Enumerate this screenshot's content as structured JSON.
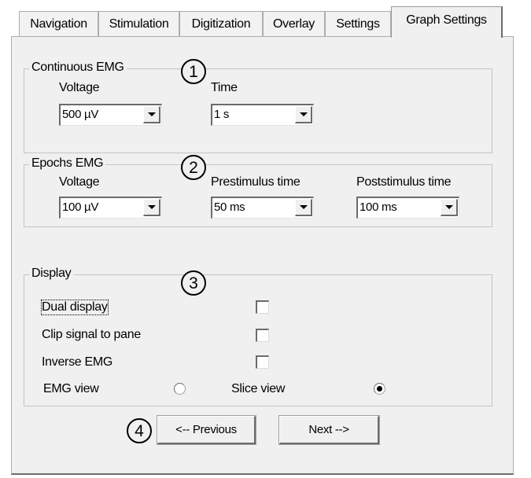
{
  "tabs": [
    {
      "label": "Navigation"
    },
    {
      "label": "Stimulation"
    },
    {
      "label": "Digitization"
    },
    {
      "label": "Overlay"
    },
    {
      "label": "Settings"
    },
    {
      "label": "Graph Settings"
    }
  ],
  "active_tab": "Graph Settings",
  "continuous_emg": {
    "title": "Continuous EMG",
    "marker": "1",
    "voltage_label": "Voltage",
    "voltage_value": "500 µV",
    "time_label": "Time",
    "time_value": "1 s"
  },
  "epochs_emg": {
    "title": "Epochs EMG",
    "marker": "2",
    "voltage_label": "Voltage",
    "voltage_value": "100 µV",
    "prestim_label": "Prestimulus time",
    "prestim_value": "50 ms",
    "poststim_label": "Poststimulus time",
    "poststim_value": "100 ms"
  },
  "display": {
    "title": "Display",
    "marker": "3",
    "dual_display_label": "Dual display",
    "dual_display_checked": false,
    "clip_signal_label": "Clip signal to pane",
    "clip_signal_checked": false,
    "inverse_emg_label": "Inverse EMG",
    "inverse_emg_checked": false,
    "emg_view_label": "EMG view",
    "slice_view_label": "Slice view",
    "selected_view": "Slice view"
  },
  "nav": {
    "marker": "4",
    "previous_label": "<-- Previous",
    "next_label": "Next -->"
  }
}
